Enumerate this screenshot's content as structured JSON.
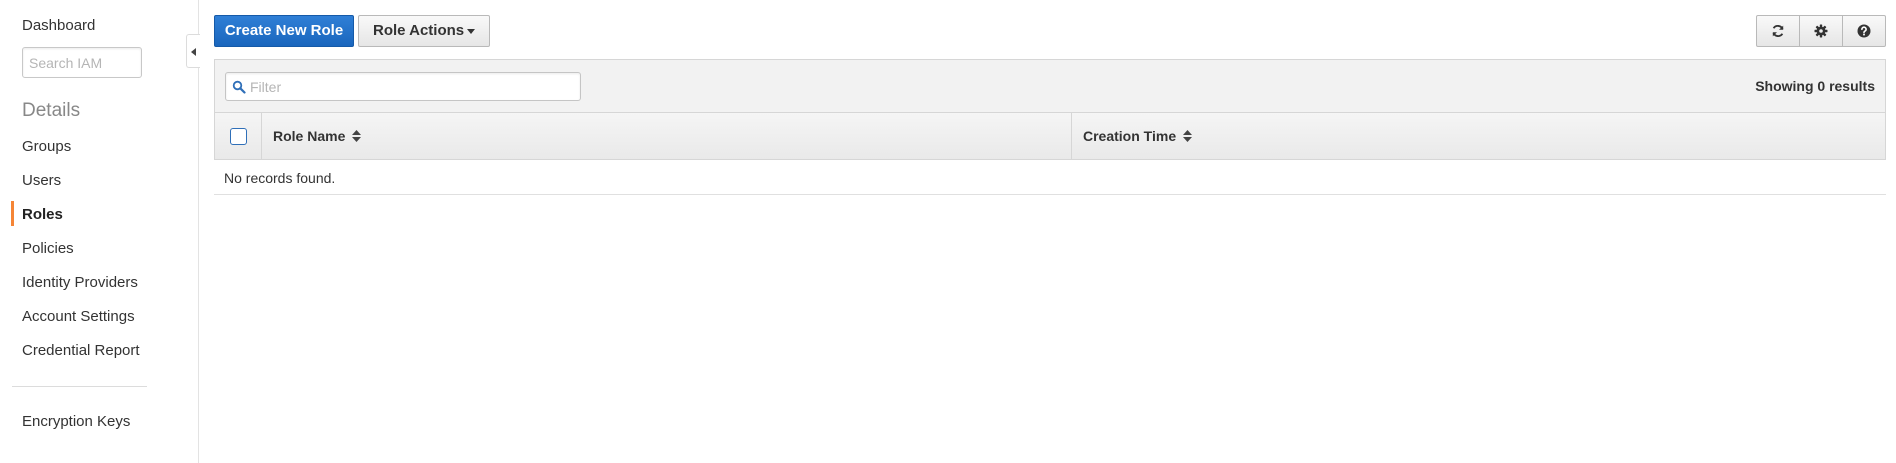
{
  "sidebar": {
    "dashboard": "Dashboard",
    "search_placeholder": "Search IAM",
    "details_heading": "Details",
    "items": [
      {
        "label": "Groups"
      },
      {
        "label": "Users"
      },
      {
        "label": "Roles",
        "active": true
      },
      {
        "label": "Policies"
      },
      {
        "label": "Identity Providers"
      },
      {
        "label": "Account Settings"
      },
      {
        "label": "Credential Report"
      }
    ],
    "footer_item": "Encryption Keys",
    "accent_color": "#f58536"
  },
  "toolbar": {
    "create_label": "Create New Role",
    "actions_label": "Role Actions",
    "icons": [
      "refresh-icon",
      "gear-icon",
      "help-icon"
    ],
    "primary_color": "#1a66bd"
  },
  "table": {
    "filter_placeholder": "Filter",
    "results": "Showing 0 results",
    "columns": [
      "Role Name",
      "Creation Time"
    ],
    "empty_message": "No records found."
  }
}
